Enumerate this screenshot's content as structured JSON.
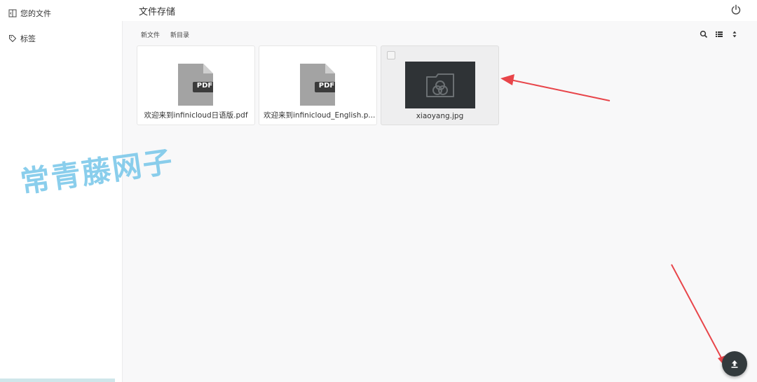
{
  "sidebar": {
    "items": [
      {
        "label": "您的文件",
        "icon": "sidebar-panel-icon"
      },
      {
        "label": "标签",
        "icon": "tag-icon"
      }
    ]
  },
  "header": {
    "title": "文件存储",
    "power_icon": "power-icon"
  },
  "toolbar": {
    "new_file": "新文件",
    "new_dir": "新目录",
    "icons": [
      "search-icon",
      "list-view-icon",
      "sort-icon"
    ]
  },
  "files": [
    {
      "name": "欢迎来到infinicloud日语版.pdf",
      "type": "pdf",
      "badge": "PDF"
    },
    {
      "name": "欢迎来到infinicloud_English.p...",
      "type": "pdf",
      "badge": "PDF"
    },
    {
      "name": "xiaoyang.jpg",
      "type": "image",
      "selected": true
    }
  ],
  "watermark": "常青藤网子",
  "upload_icon": "upload-icon",
  "colors": {
    "annotation_arrow": "#e8454a",
    "fab": "#333a3d",
    "thumb_bg": "#2f3336"
  }
}
